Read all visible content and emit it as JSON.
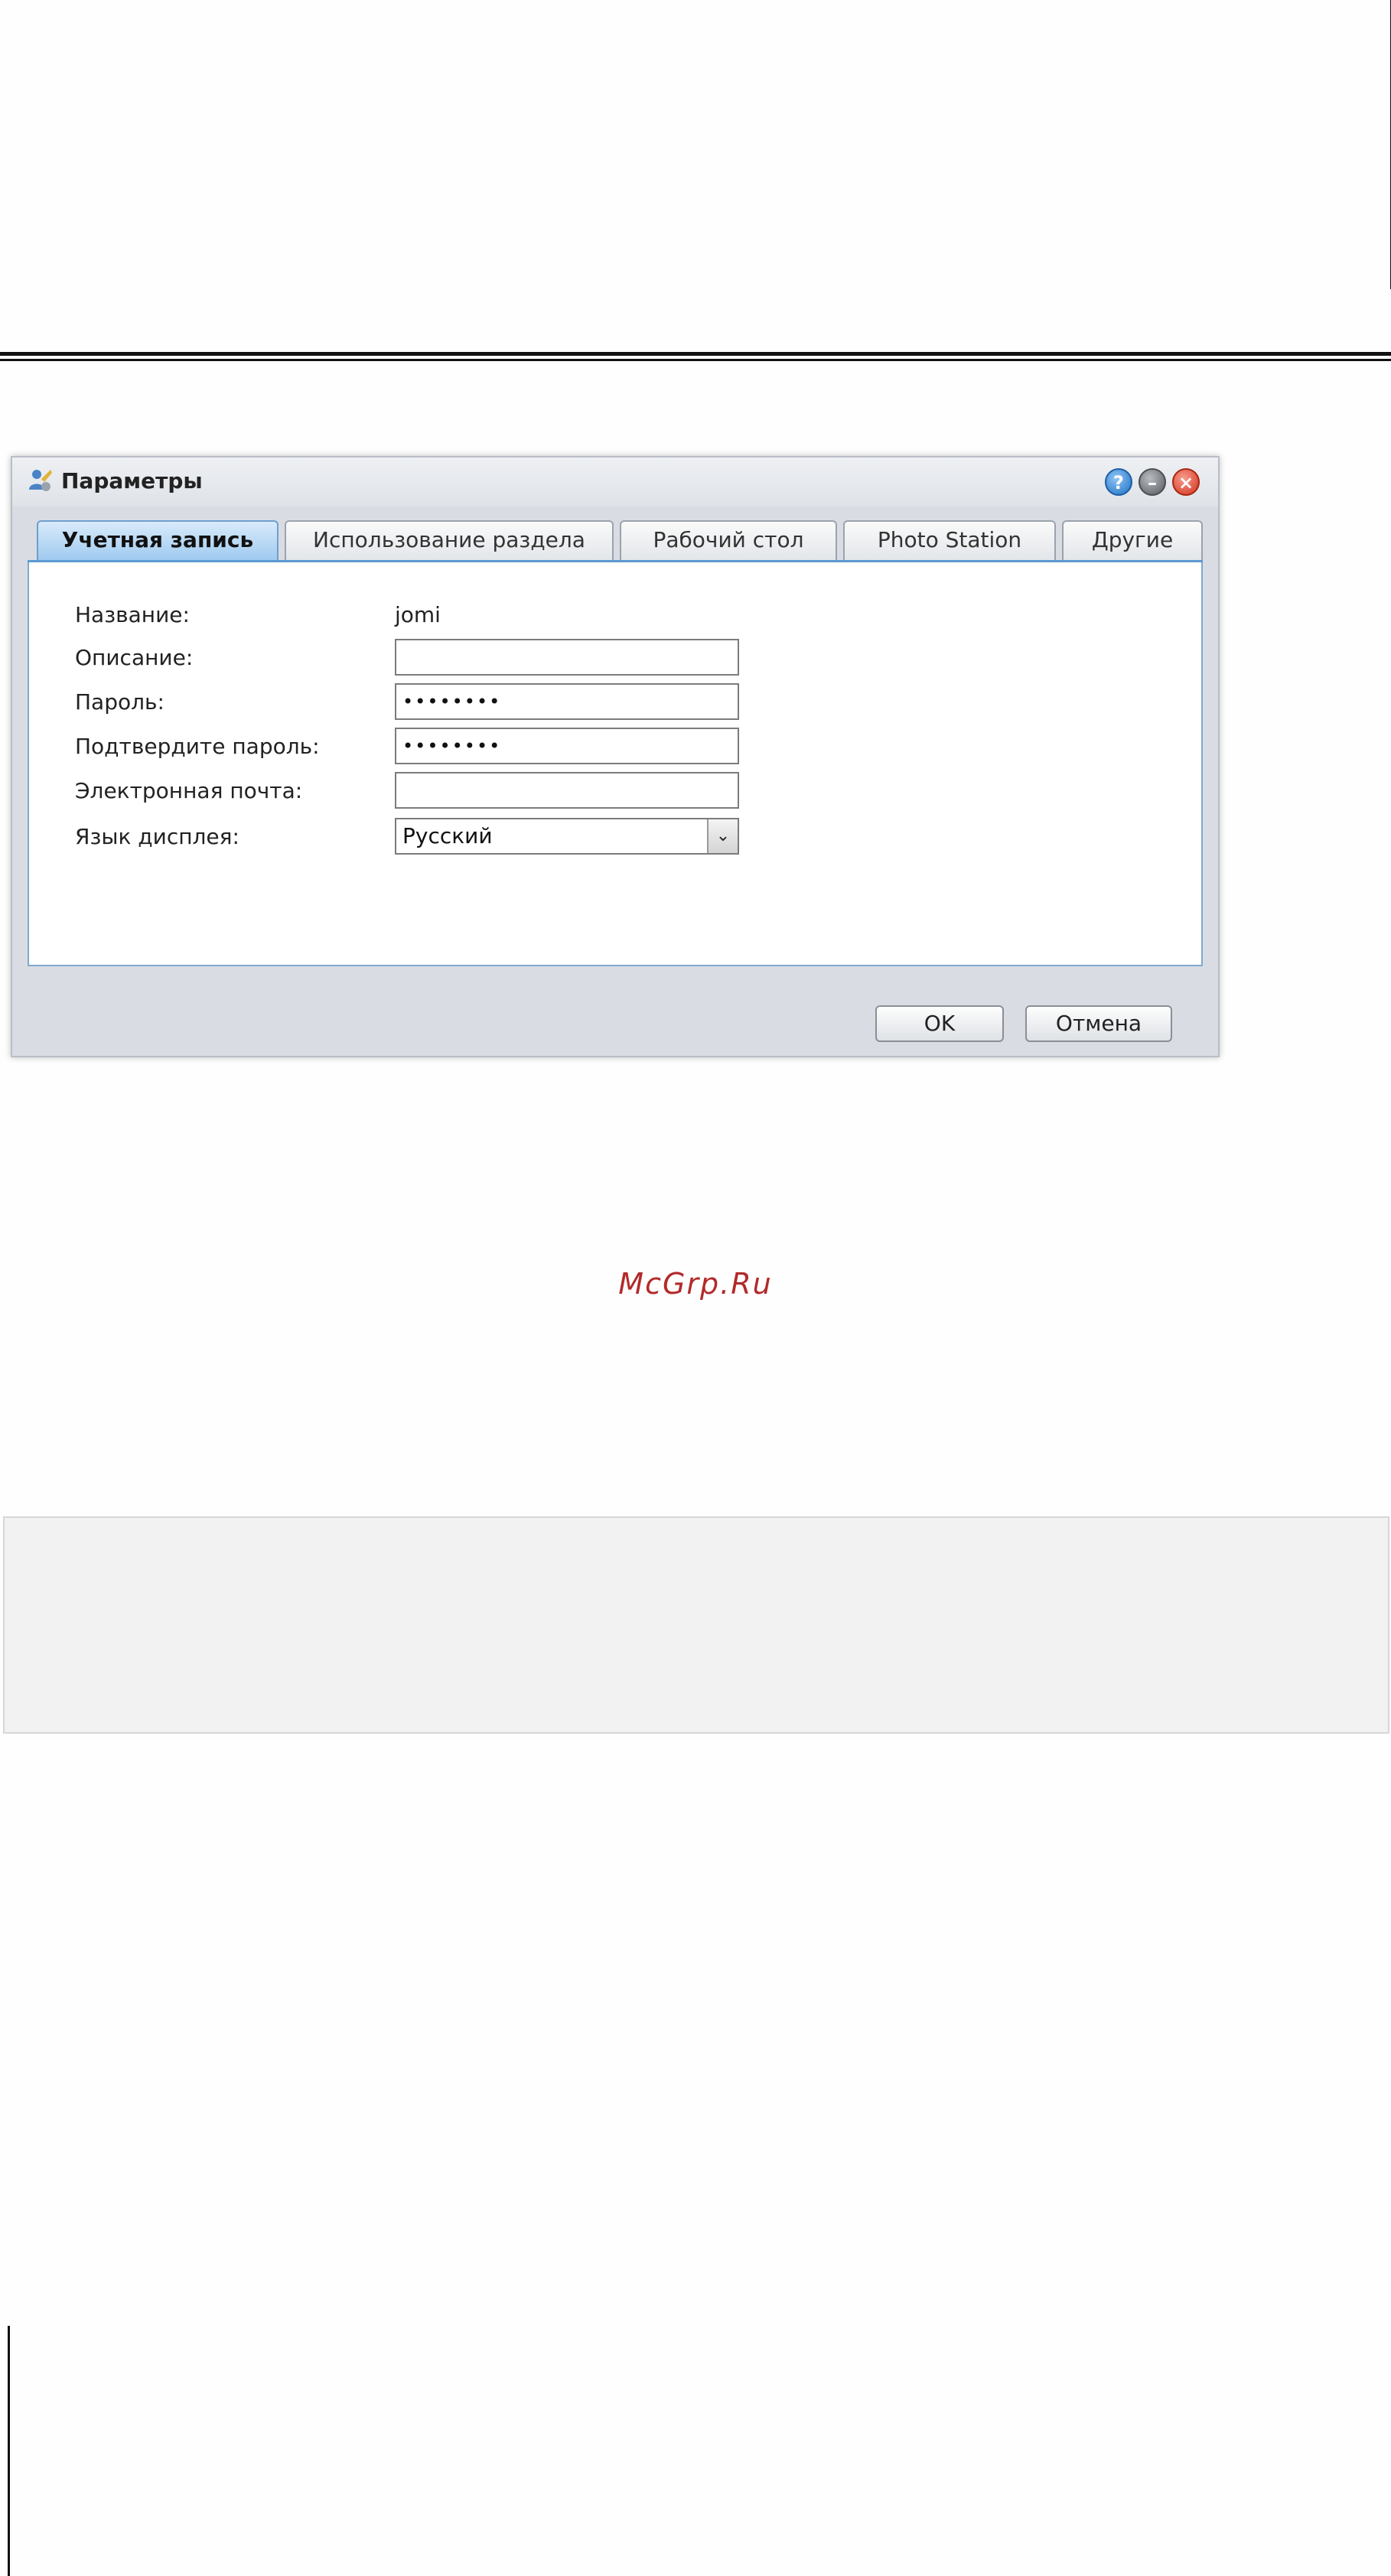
{
  "window": {
    "title": "Параметры"
  },
  "tabs": [
    {
      "label": "Учетная запись",
      "active": true
    },
    {
      "label": "Использование раздела",
      "active": false
    },
    {
      "label": "Рабочий стол",
      "active": false
    },
    {
      "label": "Photo Station",
      "active": false
    },
    {
      "label": "Другие",
      "active": false
    }
  ],
  "form": {
    "name_label": "Название:",
    "name_value": "jomi",
    "description_label": "Описание:",
    "description_value": "",
    "password_label": "Пароль:",
    "password_value": "••••••••",
    "confirm_label": "Подтвердите пароль:",
    "confirm_value": "••••••••",
    "email_label": "Электронная почта:",
    "email_value": "",
    "language_label": "Язык дисплея:",
    "language_value": "Русский"
  },
  "buttons": {
    "ok_label": "OK",
    "cancel_label": "Отмена"
  },
  "watermark": "McGrp.Ru",
  "colors": {
    "accent": "#5c9ad2",
    "watermark": "#b22a2a",
    "close": "#d2311c",
    "help": "#1f6fc4"
  }
}
